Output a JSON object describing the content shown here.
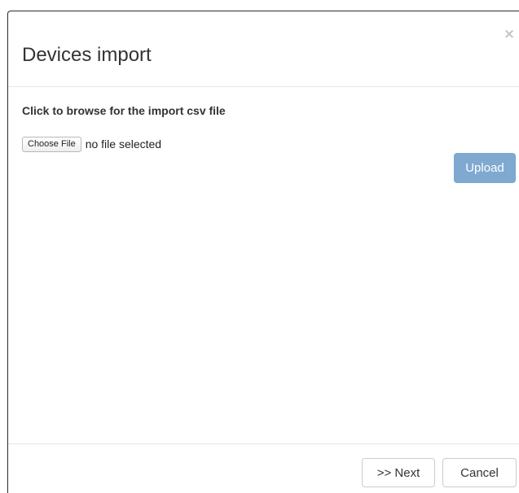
{
  "dialog": {
    "title": "Devices import",
    "close_symbol": "×",
    "close_icon": "close-icon"
  },
  "body": {
    "instruction": "Click to browse for the import csv file",
    "file_input": {
      "button_label": "Choose File",
      "status": "no file selected"
    },
    "upload_label": "Upload"
  },
  "footer": {
    "next_label": ">> Next",
    "cancel_label": "Cancel"
  },
  "colors": {
    "upload_button": "#7fa9d1",
    "title_text": "#333333",
    "divider": "#e5e5e5"
  }
}
